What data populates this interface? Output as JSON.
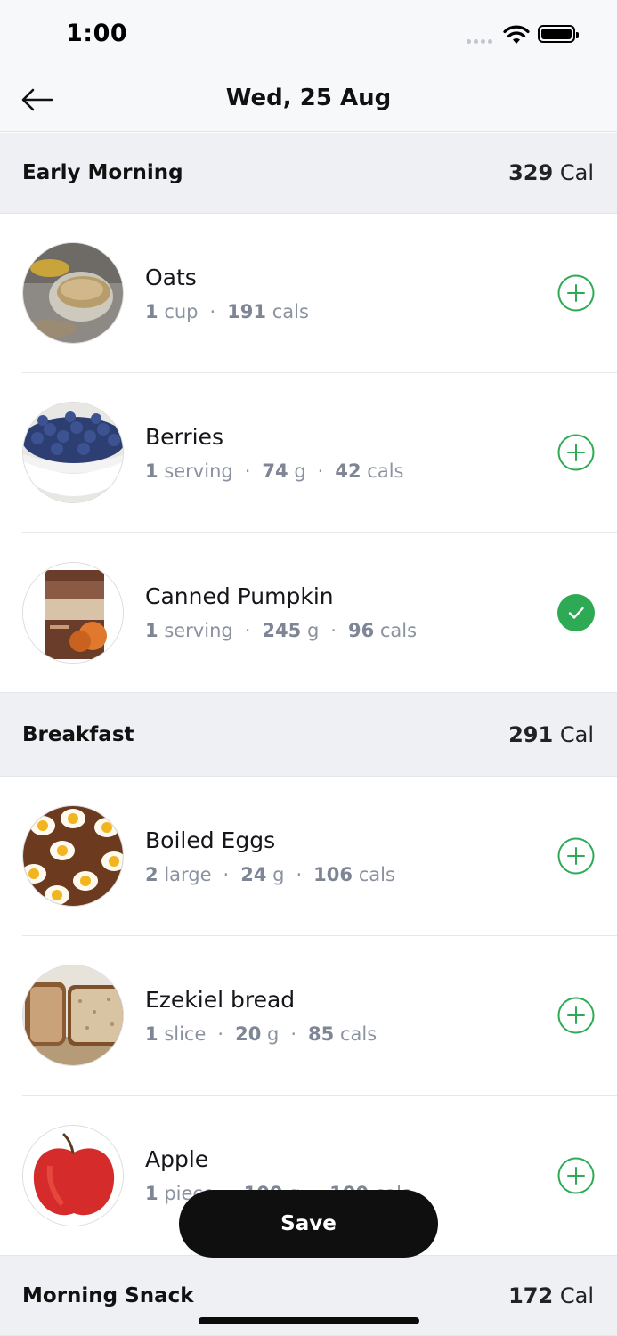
{
  "status_bar": {
    "time": "1:00"
  },
  "nav": {
    "title": "Wed, 25 Aug"
  },
  "sections": [
    {
      "name": "Early Morning",
      "cal_value": "329",
      "cal_unit": "Cal",
      "items": [
        {
          "name": "Oats",
          "meta": [
            {
              "num": "1",
              "unit": "cup"
            },
            {
              "num": "191",
              "unit": "cals"
            }
          ],
          "state": "add",
          "icon": "oats-photo"
        },
        {
          "name": "Berries",
          "meta": [
            {
              "num": "1",
              "unit": "serving"
            },
            {
              "num": "74",
              "unit": "g"
            },
            {
              "num": "42",
              "unit": "cals"
            }
          ],
          "state": "add",
          "icon": "berries-photo"
        },
        {
          "name": "Canned Pumpkin",
          "meta": [
            {
              "num": "1",
              "unit": "serving"
            },
            {
              "num": "245",
              "unit": "g"
            },
            {
              "num": "96",
              "unit": "cals"
            }
          ],
          "state": "added",
          "icon": "pumpkin-can-photo"
        }
      ]
    },
    {
      "name": "Breakfast",
      "cal_value": "291",
      "cal_unit": "Cal",
      "items": [
        {
          "name": "Boiled Eggs",
          "meta": [
            {
              "num": "2",
              "unit": "large"
            },
            {
              "num": "24",
              "unit": "g"
            },
            {
              "num": "106",
              "unit": "cals"
            }
          ],
          "state": "add",
          "icon": "eggs-photo"
        },
        {
          "name": "Ezekiel bread",
          "meta": [
            {
              "num": "1",
              "unit": "slice"
            },
            {
              "num": "20",
              "unit": "g"
            },
            {
              "num": "85",
              "unit": "cals"
            }
          ],
          "state": "add",
          "icon": "bread-photo"
        },
        {
          "name": "Apple",
          "meta": [
            {
              "num": "1",
              "unit": "piece"
            },
            {
              "num": "100",
              "unit": "g"
            },
            {
              "num": "100",
              "unit": "cals"
            }
          ],
          "state": "add",
          "icon": "apple-photo"
        }
      ]
    },
    {
      "name": "Morning Snack",
      "cal_value": "172",
      "cal_unit": "Cal",
      "items": []
    }
  ],
  "save_label": "Save",
  "colors": {
    "accent_green": "#2eaa55",
    "header_bg": "#eef0f4",
    "meta_gray": "#8b92a0"
  }
}
